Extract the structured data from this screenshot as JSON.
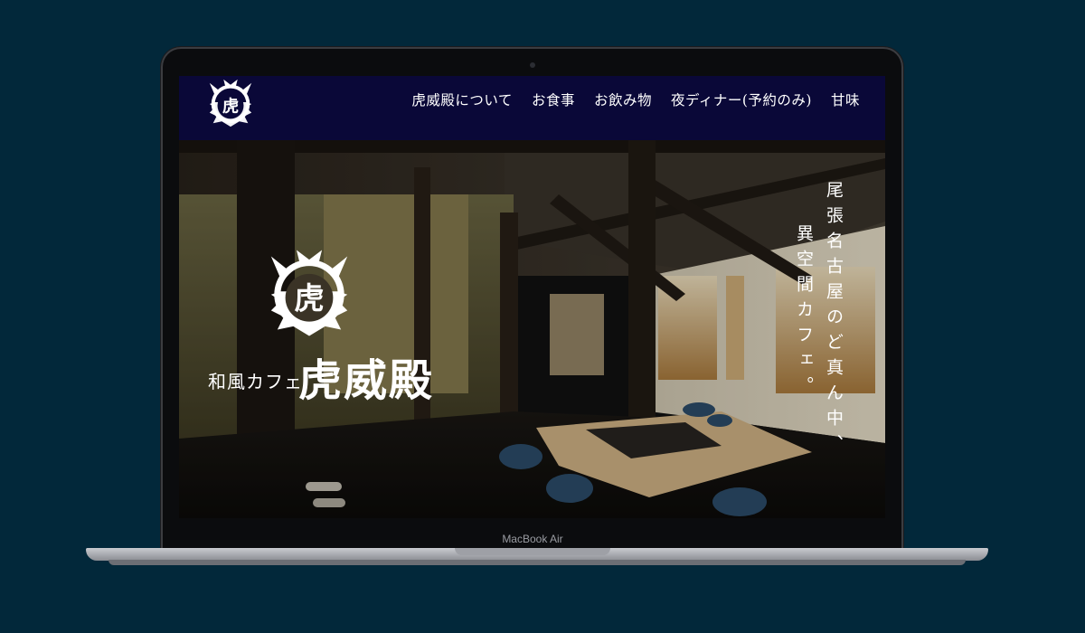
{
  "device": {
    "model_label": "MacBook Air"
  },
  "site": {
    "nav": [
      {
        "label": "虎威殿について"
      },
      {
        "label": "お食事"
      },
      {
        "label": "お飲み物"
      },
      {
        "label": "夜ディナー(予約のみ)"
      },
      {
        "label": "甘味"
      }
    ],
    "logo_glyph": "虎",
    "hero": {
      "subtitle": "和風カフェ",
      "name": "虎威殿",
      "tagline_line1": "尾張名古屋のど真ん中、",
      "tagline_line2": "異空間カフェ。"
    }
  },
  "colors": {
    "background": "#02283a",
    "header": "#0a0838",
    "text": "#ffffff"
  }
}
